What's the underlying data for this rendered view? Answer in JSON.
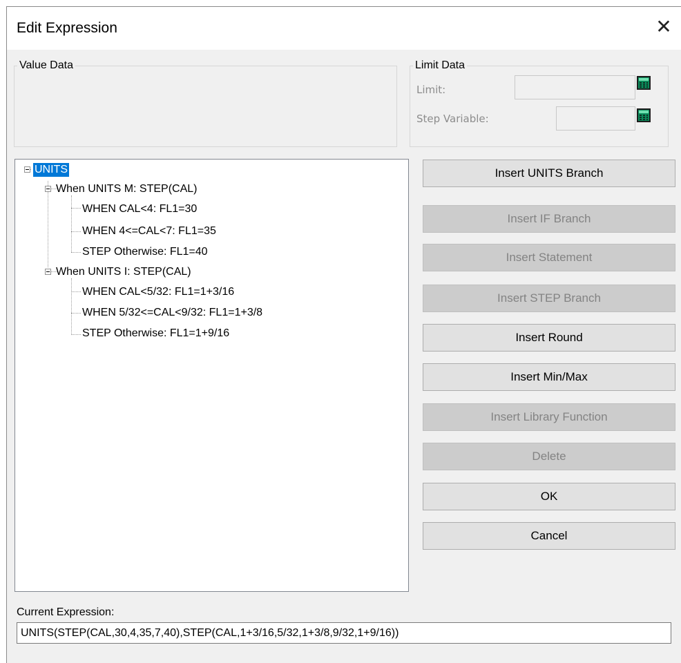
{
  "window": {
    "title": "Edit Expression",
    "close_glyph": "✕"
  },
  "value_data": {
    "legend": "Value Data"
  },
  "limit_data": {
    "legend": "Limit Data",
    "limit_label": "Limit:",
    "limit_value": "",
    "step_variable_label": "Step Variable:",
    "step_variable_value": "",
    "calculator_icon": "calculator-icon"
  },
  "tree": {
    "root": "UNITS",
    "nodes": [
      {
        "label": "When UNITS M: STEP(CAL)"
      },
      {
        "label": "WHEN CAL<4: FL1=30"
      },
      {
        "label": "WHEN 4<=CAL<7: FL1=35"
      },
      {
        "label": "STEP Otherwise: FL1=40"
      },
      {
        "label": "When UNITS I: STEP(CAL)"
      },
      {
        "label": "WHEN CAL<5/32: FL1=1+3/16"
      },
      {
        "label": "WHEN 5/32<=CAL<9/32: FL1=1+3/8"
      },
      {
        "label": "STEP Otherwise: FL1=1+9/16"
      }
    ]
  },
  "buttons": [
    {
      "label": "Insert UNITS Branch",
      "enabled": true
    },
    {
      "label": "Insert IF Branch",
      "enabled": false
    },
    {
      "label": "Insert Statement",
      "enabled": false
    },
    {
      "label": "Insert STEP Branch",
      "enabled": false
    },
    {
      "label": "Insert Round",
      "enabled": true
    },
    {
      "label": "Insert Min/Max",
      "enabled": true
    },
    {
      "label": "Insert Library Function",
      "enabled": false
    },
    {
      "label": "Delete",
      "enabled": false
    },
    {
      "label": "OK",
      "enabled": true
    },
    {
      "label": "Cancel",
      "enabled": true
    }
  ],
  "current_expression": {
    "label": "Current Expression:",
    "value": "UNITS(STEP(CAL,30,4,35,7,40),STEP(CAL,1+3/16,5/32,1+3/8,9/32,1+9/16))"
  },
  "colors": {
    "selection": "#0078d7",
    "dialog_bg": "#f0f0f0",
    "disabled_text": "#838383"
  }
}
